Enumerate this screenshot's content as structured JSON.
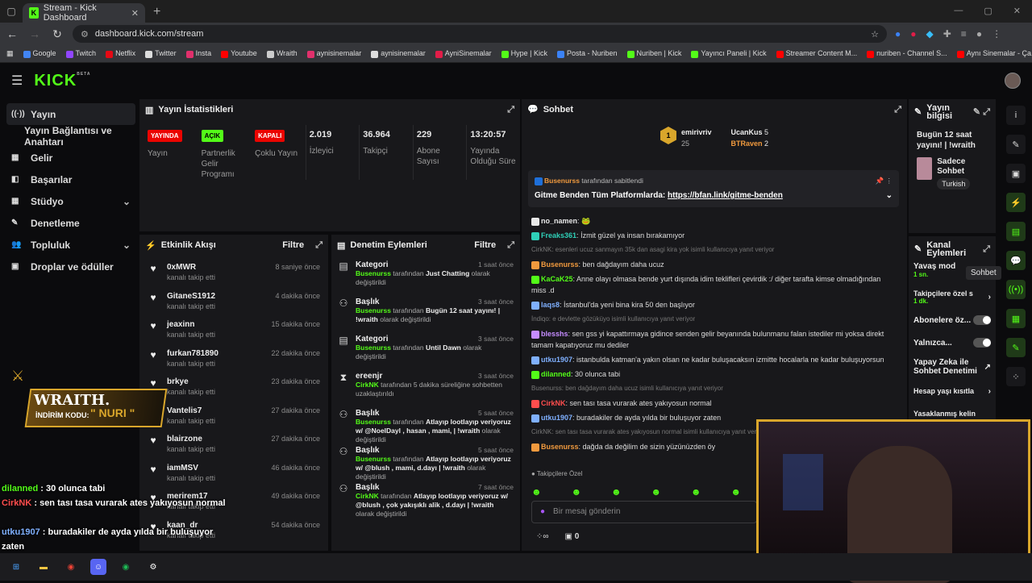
{
  "browser": {
    "tab_title": "Stream - Kick Dashboard",
    "url": "dashboard.kick.com/stream",
    "bookmarks": [
      "Google",
      "Twitch",
      "Netflix",
      "Twitter",
      "Insta",
      "Youtube",
      "Wraith",
      "aynisinemalar",
      "aynisinemalar",
      "AyniSinemalar",
      "Hype | Kick",
      "Posta - Nuriben",
      "Nuriben | Kick",
      "Yayıncı Paneli | Kick",
      "Streamer Content M...",
      "nuriben - Channel S...",
      "Aynı Sinemalar - Ça..."
    ]
  },
  "app": {
    "logo": "KICK",
    "beta": "BETA"
  },
  "sidebar": {
    "items": [
      {
        "icon": "broadcast-icon",
        "label": "Yayın",
        "active": true
      },
      {
        "icon": "",
        "label": "Yayın Bağlantısı ve Anahtarı"
      },
      {
        "icon": "dollar-icon",
        "label": "Gelir"
      },
      {
        "icon": "trophy-icon",
        "label": "Başarılar"
      },
      {
        "icon": "studio-icon",
        "label": "Stüdyo",
        "chevron": true
      },
      {
        "icon": "wrench-icon",
        "label": "Denetleme"
      },
      {
        "icon": "people-icon",
        "label": "Topluluk",
        "chevron": true
      },
      {
        "icon": "gift-icon",
        "label": "Droplar ve ödüller"
      }
    ]
  },
  "stats": {
    "title": "Yayın İstatistikleri",
    "cols": [
      {
        "badge": "YAYINDA",
        "color": "#eb0400",
        "label": "Yayın"
      },
      {
        "badge": "AÇIK",
        "color": "#53fc18",
        "label": "Partnerlik Gelir Programı"
      },
      {
        "badge": "KAPALI",
        "color": "#eb0400",
        "label": "Çoklu Yayın"
      },
      {
        "value": "2.019",
        "label": "İzleyici"
      },
      {
        "value": "36.964",
        "label": "Takipçi"
      },
      {
        "value": "229",
        "label": "Abone Sayısı"
      },
      {
        "value": "13:20:57",
        "label": "Yayında Olduğu Süre"
      }
    ]
  },
  "activity": {
    "title": "Etkinlik Akışı",
    "filter": "Filtre",
    "items": [
      {
        "name": "0xMWR",
        "sub": "kanalı takip etti",
        "time": "8 saniye önce"
      },
      {
        "name": "GitaneS1912",
        "sub": "kanalı takip etti",
        "time": "4 dakika önce"
      },
      {
        "name": "jeaxinn",
        "sub": "kanalı takip etti",
        "time": "15 dakika önce"
      },
      {
        "name": "furkan781890",
        "sub": "kanalı takip etti",
        "time": "22 dakika önce"
      },
      {
        "name": "brkye",
        "sub": "kanalı takip etti",
        "time": "23 dakika önce"
      },
      {
        "name": "Vantelis7",
        "sub": "kanalı takip etti",
        "time": "27 dakika önce"
      },
      {
        "name": "blairzone",
        "sub": "kanalı takip etti",
        "time": "27 dakika önce"
      },
      {
        "name": "iamMSV",
        "sub": "kanalı takip etti",
        "time": "46 dakika önce"
      },
      {
        "name": "merirem17",
        "sub": "kanalı takip etti",
        "time": "49 dakika önce"
      },
      {
        "name": "kaan_dr",
        "sub": "kanalı takip etti",
        "time": "54 dakika önce"
      }
    ]
  },
  "modlog": {
    "title": "Denetim Eylemleri",
    "filter": "Filtre",
    "items": [
      {
        "icon": "category-icon",
        "title": "Kategori",
        "time": "1 saat önce",
        "actor": "Busenurss",
        "mid": " tarafından ",
        "target": "Just Chatting",
        "end": " olarak değiştirildi"
      },
      {
        "icon": "title-icon",
        "title": "Başlık",
        "time": "3 saat önce",
        "actor": "Busenurss",
        "mid": " tarafından ",
        "target": "Bugün 12 saat yayını! | !wraith",
        "end": " olarak değiştirildi"
      },
      {
        "icon": "category-icon",
        "title": "Kategori",
        "time": "3 saat önce",
        "actor": "Busenurss",
        "mid": " tarafından ",
        "target": "Until Dawn",
        "end": " olarak değiştirildi"
      },
      {
        "icon": "hourglass-icon",
        "title": "ereenjr",
        "time": "3 saat önce",
        "actor": "CirkNK",
        "mid": " tarafından 5 dakika süreliğine sohbetten uzaklaştırıldı",
        "target": "",
        "end": ""
      },
      {
        "icon": "title-icon",
        "title": "Başlık",
        "time": "5 saat önce",
        "actor": "Busenurss",
        "mid": " tarafından ",
        "target": "Atlayıp lootlayıp veriyoruz w/ @NoelDayl , hasan , mami, | !wraith",
        "end": " olarak değiştirildi"
      },
      {
        "icon": "title-icon",
        "title": "Başlık",
        "time": "5 saat önce",
        "actor": "Busenurss",
        "mid": " tarafından ",
        "target": "Atlayıp lootlayıp veriyoruz w/ @blush , mami, d.dayı | !wraith",
        "end": " olarak değiştirildi"
      },
      {
        "icon": "title-icon",
        "title": "Başlık",
        "time": "7 saat önce",
        "actor": "CirkNK",
        "mid": " tarafından ",
        "target": "Atlayıp lootlayıp veriyoruz w/ @blush , çok yakışıklı alik , d.dayı | !wraith",
        "end": " olarak değiştirildi"
      }
    ]
  },
  "chat": {
    "title": "Sohbet",
    "top": [
      {
        "rank": "1",
        "name": "emirivriv",
        "count": "25"
      },
      {
        "name": "UcanKus",
        "count": "5"
      },
      {
        "name": "BTRaven",
        "count": "2"
      }
    ],
    "pinned": {
      "by": "Busenurss",
      "by_text": " tarafından sabitlendi",
      "text": "Gitme Benden Tüm Platformlarda: ",
      "link": "https://bfan.link/gitme-benden"
    },
    "messages": [
      {
        "user": "no_namen",
        "color": "#e8e8e8",
        "text": " 🐸"
      },
      {
        "user": "Freaks361",
        "color": "#2fd0b8",
        "text": "İzmit güzel ya insan bırakamıyor"
      },
      {
        "sys": "CirkNK: esenleri ucuz sanmayın 35k dan asagi kira yok isimli kullanıcıya yanıt veriyor"
      },
      {
        "user": "Busenurss",
        "color": "#f19a3e",
        "text": "ben dağdayım daha ucuz"
      },
      {
        "user": "KaCaK25",
        "color": "#53fc18",
        "text": "Anne olayı olmasa bende yurt dışında idim teklifleri çevirdik :/ diğer tarafta kimse olmadığından miss .d"
      },
      {
        "user": "laqs8",
        "color": "#7fb0ff",
        "text": "İstanbul'da yeni bina kira 50 den başlıyor"
      },
      {
        "sys": "İndiqo: e devlette gözüküyo isimli kullanıcıya yanıt veriyor"
      },
      {
        "user": "blesshs",
        "color": "#c58cff",
        "text": "sen gss yi kapattırmaya gidince senden gelir beyanında bulunmanu falan istediler mi yoksa direkt tamam kapatıyoruz mu dediler"
      },
      {
        "user": "utku1907",
        "color": "#7fb0ff",
        "text": "istanbulda katman'a yakın olsan ne kadar buluşacaksın izmitte hocalarla ne kadar buluşuyorsun"
      },
      {
        "user": "dilanned",
        "color": "#53fc18",
        "text": "30 olunca tabi"
      },
      {
        "sys": "Busenurss: ben dağdayım daha ucuz isimli kullanıcıya yanıt veriyor"
      },
      {
        "user": "CirkNK",
        "color": "#ff4d4d",
        "text": "sen tası tasa vurarak ates yakıyosun normal"
      },
      {
        "user": "utku1907",
        "color": "#7fb0ff",
        "text": "buradakiler de ayda yılda bir buluşuyor zaten"
      },
      {
        "sys": "CirkNK: sen tası tasa vurarak ates yakıyosun normal isimli kullanıcıya yanıt veriyor"
      },
      {
        "user": "Busenurss",
        "color": "#f19a3e",
        "text": "dağda da değilim de sizin yüzünüzden öy"
      }
    ],
    "followers_only": "Takipçilere Özel",
    "input_placeholder": "Bir mesaj gönderin",
    "bottom_count": "0"
  },
  "stream_info": {
    "title": "Yayın bilgisi",
    "stream_title": "Bugün 12 saat yayını! | !wraith",
    "mode": "Sadece Sohbet",
    "lang": "Turkish"
  },
  "channel_actions": {
    "title": "Kanal Eylemleri",
    "slow": "Yavaş mod",
    "slow_val": "1 sn.",
    "followers": "Takipçilere özel s",
    "followers_val": "1 dk.",
    "subs": "Abonelere öz...",
    "only": "Yalnızca...",
    "ai": "Yapay Zeka ile Sohbet Denetimi",
    "age": "Hesap yaşı kısıtla",
    "banned": "Yasaklanmış kelin",
    "tooltip": "Sohbet"
  },
  "overlay": {
    "brand": "WRAITH.",
    "code_label": "İNDİRİM KODU:",
    "code": "\" NURI \""
  },
  "big_chat": [
    {
      "user": "dilanned",
      "color": "#53fc18",
      "text": " : 30 olunca tabi"
    },
    {
      "user": "CirkNK",
      "color": "#ff4d4d",
      "text": " : sen tası tasa vurarak ates yakıyosun normal"
    },
    {
      "user": "utku1907",
      "color": "#7fb0ff",
      "text": " : buradakiler de ayda yılda bir buluşuyor zaten"
    }
  ]
}
